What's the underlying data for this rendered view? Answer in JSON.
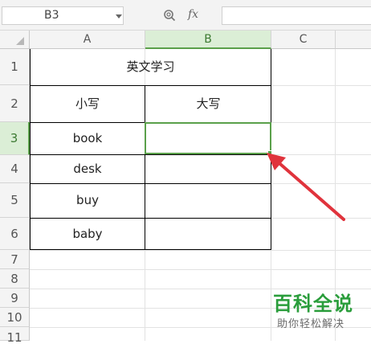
{
  "formula_bar": {
    "name_box": "B3",
    "fx_label": "fx",
    "formula_value": ""
  },
  "columns": [
    "A",
    "B",
    "C"
  ],
  "active_column": "B",
  "rows": [
    "1",
    "2",
    "3",
    "4",
    "5",
    "6",
    "7",
    "8",
    "9",
    "10",
    "11"
  ],
  "active_row": "3",
  "table": {
    "title": "英文学习",
    "header_left": "小写",
    "header_right": "大写",
    "words": [
      "book",
      "desk",
      "buy",
      "baby"
    ],
    "uppercase": [
      "",
      "",
      "",
      ""
    ]
  },
  "colors": {
    "selection": "#5aa04a",
    "arrow": "#e0333c",
    "watermark": "#2a9d3b"
  },
  "icons": [
    "dropdown-arrow-icon",
    "zoom-icon",
    "fx-icon",
    "select-all-icon",
    "annotation-arrow-icon"
  ],
  "watermark": {
    "title": "百科全说",
    "subtitle": "助你轻松解决"
  }
}
